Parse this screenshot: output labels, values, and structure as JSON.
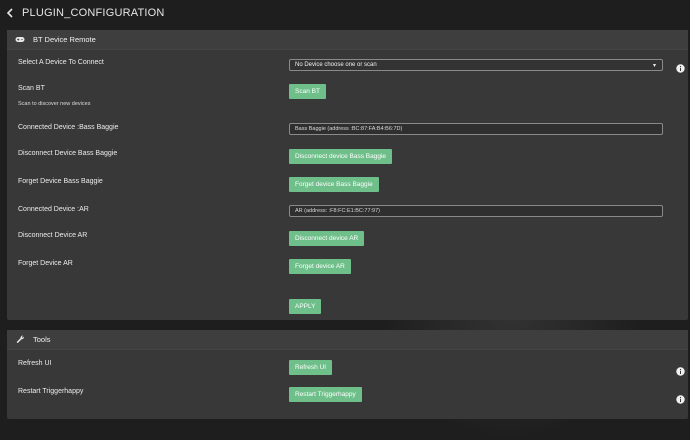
{
  "header": {
    "title": "PLUGIN_CONFIGURATION"
  },
  "bt_panel": {
    "title": "BT Device Remote",
    "select_device": {
      "label": "Select A Device To Connect",
      "value": "No Device choose one or scan"
    },
    "scan": {
      "label": "Scan BT",
      "sublabel": "Scan to discover new devices",
      "button": "Scan BT"
    },
    "connected_1": {
      "label": "Connected Device :Bass Baggie",
      "value": "Bass Baggie (address :BC:87:FA:B4:B6:7D)"
    },
    "disconnect_1": {
      "label": "Disconnect Device Bass Baggie",
      "button": "Disconnect device Bass Baggie"
    },
    "forget_1": {
      "label": "Forget Device Bass Baggie",
      "button": "Forget device Bass Baggie"
    },
    "connected_2": {
      "label": "Connected Device :AR",
      "value": "AR (address: :F8:FC:E1:BC:77:97)"
    },
    "disconnect_2": {
      "label": "Disconnect Device AR",
      "button": "Disconnect device AR"
    },
    "forget_2": {
      "label": "Forget Device AR",
      "button": "Forget device AR"
    },
    "apply_button": "APPLY"
  },
  "tools_panel": {
    "title": "Tools",
    "refresh": {
      "label": "Refresh UI",
      "button": "Refresh UI"
    },
    "restart": {
      "label": "Restart Triggerhappy",
      "button": "Restart Triggerhappy"
    }
  },
  "colors": {
    "accent": "#6fbf8a",
    "panel": "#383838",
    "background": "#1e1e1e"
  },
  "icons": [
    "chevron-left-icon",
    "gamepad-icon",
    "info-icon",
    "wrench-icon"
  ]
}
